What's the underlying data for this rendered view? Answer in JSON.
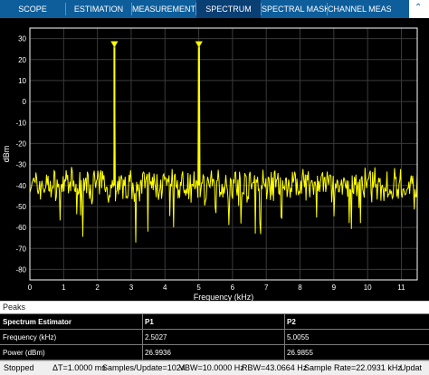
{
  "tabs": [
    {
      "label": "SCOPE",
      "selected": false
    },
    {
      "label": "ESTIMATION",
      "selected": false
    },
    {
      "label": "MEASUREMENTS",
      "selected": false
    },
    {
      "label": "SPECTRUM",
      "selected": true
    },
    {
      "label": "SPECTRAL MASK",
      "selected": false
    },
    {
      "label": "CHANNEL MEAS-",
      "selected": false
    }
  ],
  "collapse_icon": "chevron-up-icon",
  "chart_data": {
    "type": "line",
    "xlabel": "Frequency (kHz)",
    "ylabel": "dBm",
    "xlim": [
      0,
      11.47
    ],
    "ylim": [
      -85,
      35
    ],
    "xticks": [
      0,
      1,
      2,
      3,
      4,
      5,
      6,
      7,
      8,
      9,
      10,
      11
    ],
    "yticks": [
      30,
      20,
      10,
      0,
      -10,
      -20,
      -30,
      -40,
      -50,
      -60,
      -70,
      -80
    ],
    "grid": true,
    "colors": {
      "trace": "#ffff00",
      "axes": "#ffffff",
      "grid": "#3a3a3a",
      "background": "#000000"
    },
    "series": [
      {
        "noise_floor_dbm": -40,
        "peaks": [
          {
            "x": 2.5027,
            "y": 26.9936
          },
          {
            "x": 5.0055,
            "y": 26.9855
          }
        ]
      }
    ],
    "peak_markers": [
      {
        "x": 2.5027,
        "y": 26.9936
      },
      {
        "x": 5.0055,
        "y": 26.9855
      }
    ]
  },
  "peaks_panel": {
    "title": "Peaks",
    "columns": [
      "Spectrum Estimator",
      "P1",
      "P2"
    ],
    "rows": [
      [
        "Frequency (kHz)",
        "2.5027",
        "5.0055"
      ],
      [
        "Power (dBm)",
        "26.9936",
        "26.9855"
      ]
    ]
  },
  "status": {
    "state": "Stopped",
    "delta_t": "ΔT=1.0000 ms",
    "samples_per_update": "Samples/Update=1024",
    "vbw": "VBW=10.0000 Hz",
    "rbw": "RBW=43.0664 Hz",
    "sample_rate": "Sample Rate=22.0931 kHz",
    "update": "Updat"
  }
}
